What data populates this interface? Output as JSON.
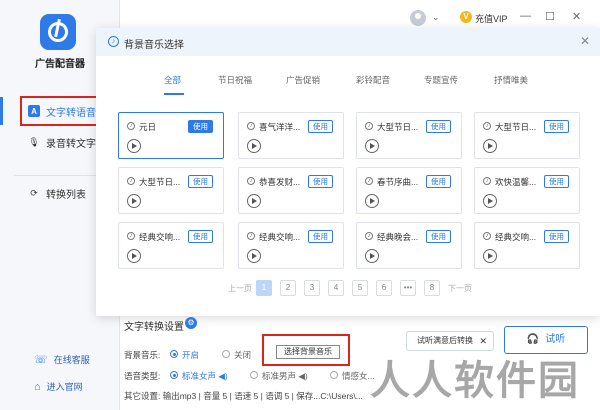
{
  "app": {
    "name": "广告配音器"
  },
  "sidebar": {
    "items": [
      {
        "label": "文字转语音",
        "icon": "A"
      },
      {
        "label": "录音转文字",
        "icon": "🎙"
      },
      {
        "label": "转换列表",
        "icon": "⟳"
      }
    ],
    "bottom": [
      {
        "label": "在线客服",
        "icon": "☏"
      },
      {
        "label": "进入官网",
        "icon": "⌂"
      }
    ]
  },
  "topbar": {
    "vip": "充值VIP",
    "vip_badge": "V",
    "minimize": "—",
    "maximize": "☐",
    "close": "✕"
  },
  "modal": {
    "title": "背景音乐选择",
    "close": "✕",
    "tabs": [
      "全部",
      "节日祝福",
      "广告促销",
      "彩铃配音",
      "专题宣传",
      "抒情唯美"
    ],
    "use_label": "使用",
    "tracks": [
      "元日",
      "喜气洋洋...",
      "大型节日...",
      "大型节日...",
      "大型节日...",
      "恭喜发财...",
      "春节序曲...",
      "欢快温馨...",
      "经典交响...",
      "经典交响...",
      "经典晚会...",
      "经典交响..."
    ],
    "pager": {
      "prev": "上一页",
      "next": "下一页",
      "pages": [
        "1",
        "2",
        "3",
        "4",
        "5",
        "6",
        "•••",
        "8"
      ]
    }
  },
  "settings": {
    "title": "文字转换设置",
    "gear": "⚙",
    "bg_music_label": "背景音乐:",
    "on_label": "开启",
    "off_label": "关闭",
    "choose_bg": "选择背景音乐",
    "voice_label": "语音类型:",
    "voice_opts": [
      "标准女声 ◀)",
      "标准男声 ◀)",
      "情感女..."
    ],
    "tooltip": "试听满意后转换",
    "tooltip_close": "✕",
    "listen": "试听",
    "other": "其它设置:   输出mp3  |  音量 5  |  语速 5  |  语调 5  |  保存...C:\\Users\\..."
  },
  "watermark": "人人软件园"
}
